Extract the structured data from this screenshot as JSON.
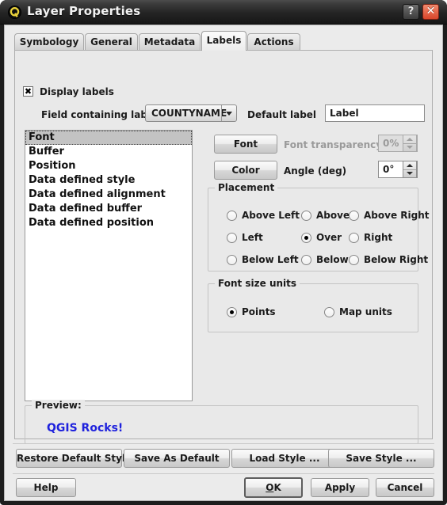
{
  "window": {
    "title": "Layer Properties",
    "logo_icon": "qgis-q-logo-icon",
    "help_button": "?",
    "close_button": "✕"
  },
  "tabs": [
    {
      "label": "Symbology",
      "active": false
    },
    {
      "label": "General",
      "active": false
    },
    {
      "label": "Metadata",
      "active": false
    },
    {
      "label": "Labels",
      "active": true
    },
    {
      "label": "Actions",
      "active": false
    }
  ],
  "labels_tab": {
    "display_labels": {
      "label": "Display labels",
      "checked": true,
      "mark": "✖"
    },
    "field_containing_label": {
      "label": "Field containing label",
      "value": "COUNTYNAME",
      "arrow_icon": "chevron-down-icon"
    },
    "default_label": {
      "label": "Default label",
      "value": "Label",
      "placeholder": ""
    },
    "category_list": {
      "items": [
        "Font",
        "Buffer",
        "Position",
        "Data defined style",
        "Data defined alignment",
        "Data defined buffer",
        "Data defined position"
      ],
      "selected_index": 0
    },
    "font_button": "Font",
    "color_button": "Color",
    "font_transparency": {
      "label": "Font transparency",
      "value": "0%",
      "enabled": false
    },
    "angle": {
      "label": "Angle (deg)",
      "value": "0°",
      "enabled": true
    },
    "placement": {
      "title": "Placement",
      "options": [
        {
          "label": "Above Left",
          "selected": false
        },
        {
          "label": "Above",
          "selected": false
        },
        {
          "label": "Above Right",
          "selected": false
        },
        {
          "label": "Left",
          "selected": false
        },
        {
          "label": "Over",
          "selected": true
        },
        {
          "label": "Right",
          "selected": false
        },
        {
          "label": "Below Left",
          "selected": false
        },
        {
          "label": "Below",
          "selected": false
        },
        {
          "label": "Below Right",
          "selected": false
        }
      ]
    },
    "font_size_units": {
      "title": "Font size units",
      "options": [
        {
          "label": "Points",
          "selected": true
        },
        {
          "label": "Map units",
          "selected": false
        }
      ]
    },
    "preview": {
      "title": "Preview:",
      "text": "QGIS Rocks!",
      "color": "#1f22dd"
    }
  },
  "style_buttons": [
    "Restore Default Style",
    "Save As Default",
    "Load Style ...",
    "Save Style ..."
  ],
  "dialog_buttons": {
    "help": "Help",
    "ok": "OK",
    "ok_accelerator": "O",
    "apply": "Apply",
    "cancel": "Cancel"
  }
}
